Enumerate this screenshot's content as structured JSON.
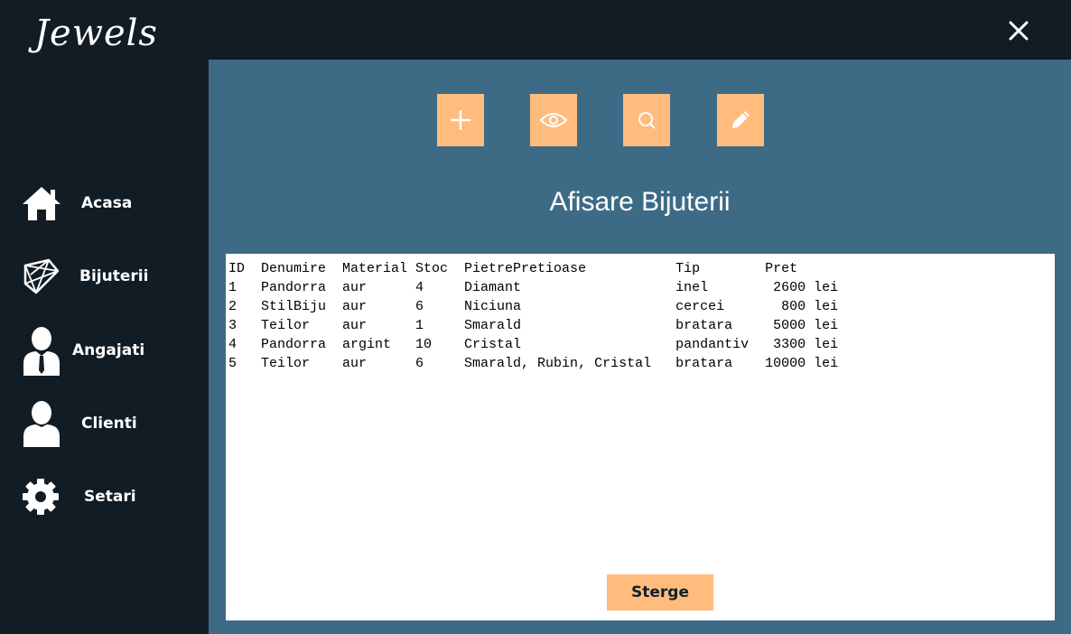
{
  "app": {
    "logo": "Jewels"
  },
  "sidebar": {
    "items": [
      {
        "label": "Acasa",
        "icon": "home-icon"
      },
      {
        "label": "Bijuterii",
        "icon": "diamond-icon"
      },
      {
        "label": "Angajati",
        "icon": "employee-icon"
      },
      {
        "label": "Clienti",
        "icon": "user-icon"
      },
      {
        "label": "Setari",
        "icon": "gear-icon"
      }
    ]
  },
  "toolbar": {
    "buttons": [
      {
        "icon": "plus-icon"
      },
      {
        "icon": "eye-icon"
      },
      {
        "icon": "search-icon"
      },
      {
        "icon": "pencil-icon"
      }
    ]
  },
  "main": {
    "title": "Afisare Bijuterii",
    "list": {
      "header": "ID  Denumire  Material Stoc  PietrePretioase           Tip        Pret",
      "rows": [
        "1   Pandorra  aur      4     Diamant                   inel        2600 lei",
        "2   StilBiju  aur      6     Niciuna                   cercei       800 lei",
        "3   Teilor    aur      1     Smarald                   bratara     5000 lei",
        "4   Pandorra  argint   10    Cristal                   pandantiv   3300 lei",
        "5   Teilor    aur      6     Smarald, Rubin, Cristal   bratara    10000 lei"
      ]
    },
    "delete_label": "Sterge"
  },
  "colors": {
    "sidebar_bg": "#121c24",
    "content_bg": "#3d6b86",
    "accent": "#ffbc7c",
    "list_bg": "#ffffff"
  }
}
